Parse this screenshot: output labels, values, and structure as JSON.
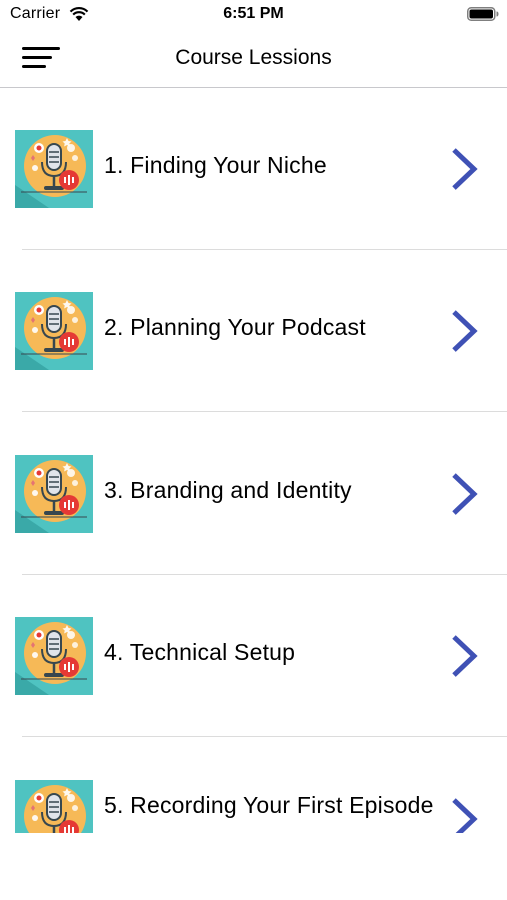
{
  "status": {
    "carrier": "Carrier",
    "time": "6:51 PM"
  },
  "nav": {
    "title": "Course Lessions"
  },
  "lessons": [
    {
      "label": "1.  Finding Your Niche"
    },
    {
      "label": "2.  Planning Your Podcast"
    },
    {
      "label": "3.  Branding and Identity"
    },
    {
      "label": "4.  Technical Setup"
    },
    {
      "label": "5.  Recording Your First Episode"
    }
  ],
  "colors": {
    "accent": "#3f51b5",
    "thumb_bg": "#4fc3c1",
    "thumb_circle": "#f6b957",
    "thumb_red": "#e53935"
  }
}
